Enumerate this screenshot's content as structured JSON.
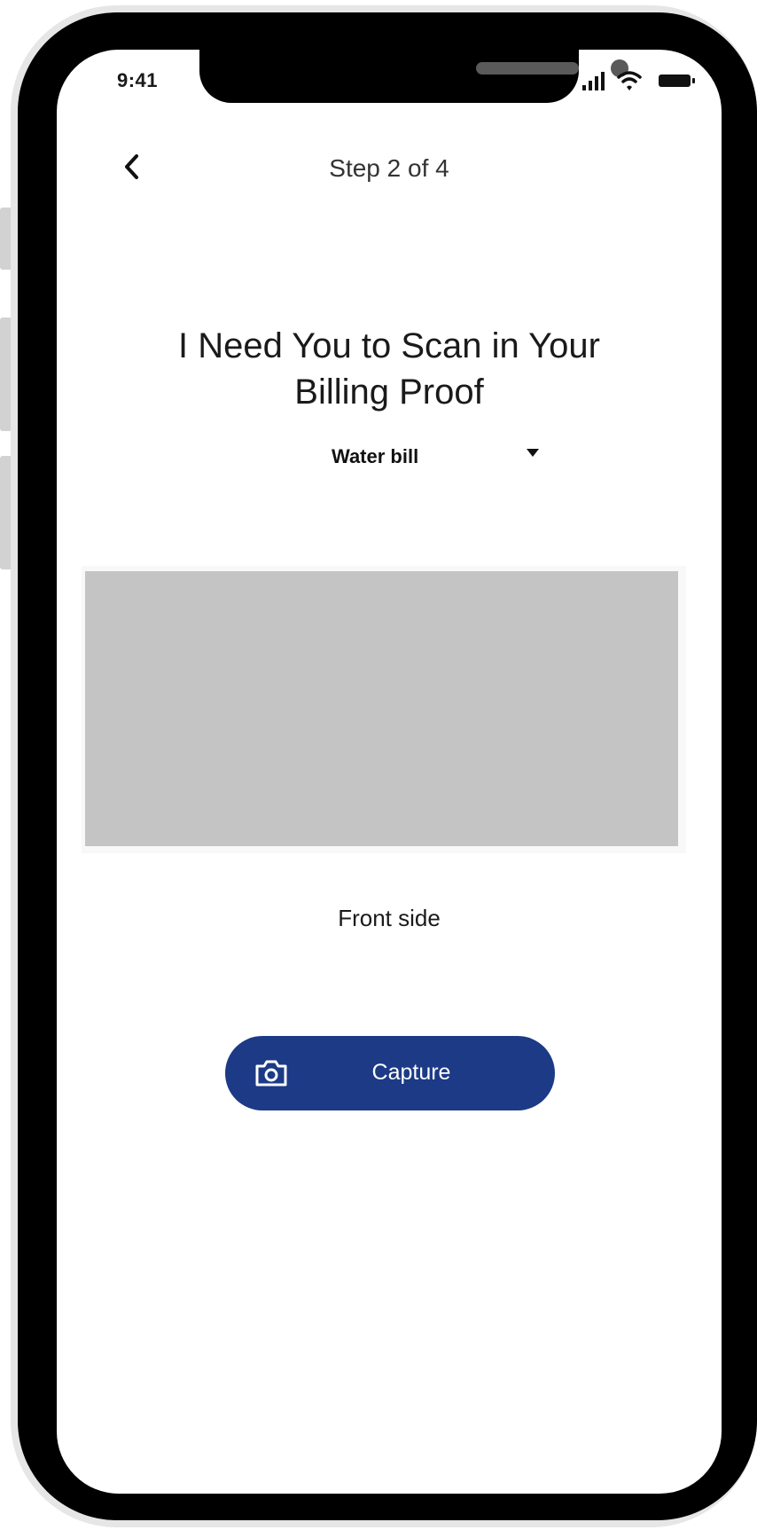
{
  "status_bar": {
    "time": "9:41",
    "icons": [
      "cellular-signal-icon",
      "wifi-icon",
      "battery-icon"
    ]
  },
  "header": {
    "back_icon": "chevron-left-icon",
    "step": "Step 2 of 4"
  },
  "main": {
    "heading_line1": "I Need You to Scan in Your",
    "heading_line2": "Billing Proof",
    "document_type": {
      "selected": "Water bill",
      "caret_icon": "caret-down-icon"
    },
    "side_label": "Front side",
    "capture": {
      "label": "Capture",
      "icon": "camera-icon"
    }
  },
  "colors": {
    "accent": "#1c3a86",
    "preview": "#c4c4c4",
    "bezel": "#000000"
  }
}
